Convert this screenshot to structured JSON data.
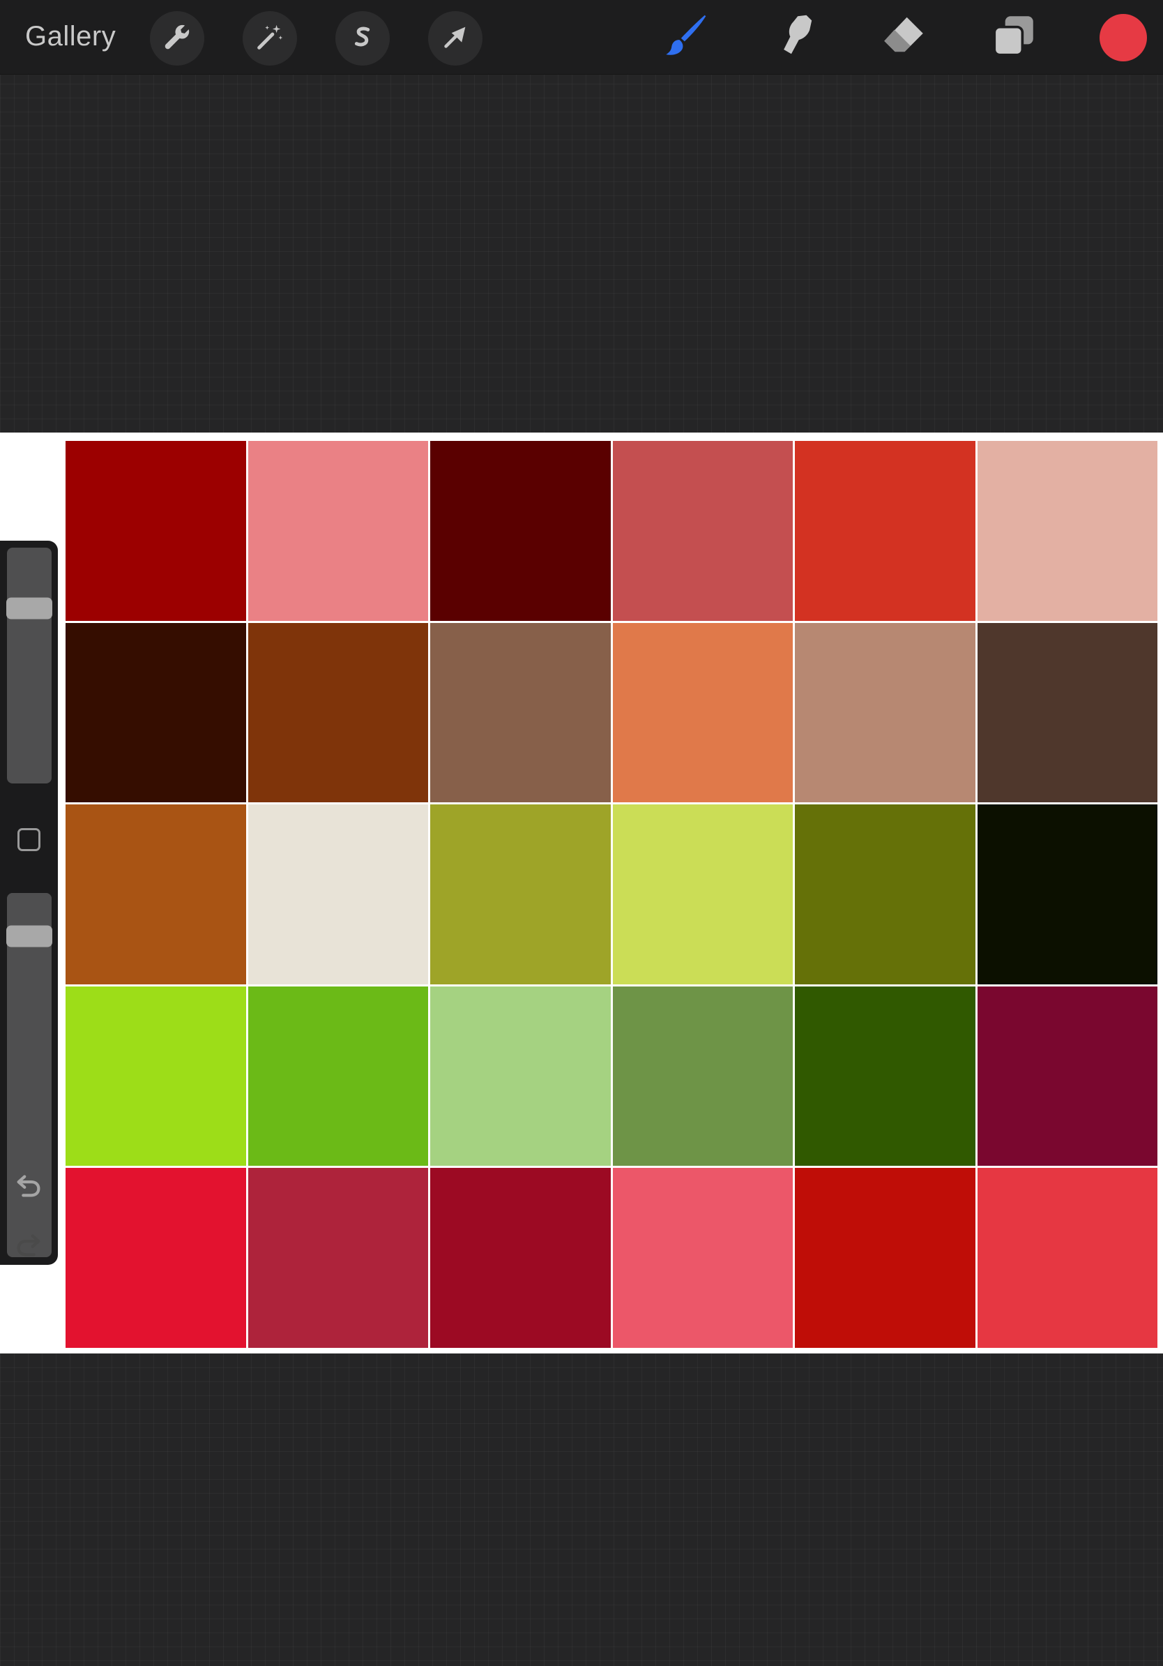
{
  "toolbar": {
    "gallery_label": "Gallery",
    "left_tools": [
      {
        "name": "actions",
        "icon": "wrench-icon"
      },
      {
        "name": "adjustments",
        "icon": "magic-wand-icon"
      },
      {
        "name": "selection",
        "icon": "selection-s-icon"
      },
      {
        "name": "transform",
        "icon": "arrow-cursor-icon"
      }
    ],
    "right_tools": [
      {
        "name": "brush",
        "icon": "brush-icon",
        "active": true,
        "color": "#2f6ff0"
      },
      {
        "name": "smudge",
        "icon": "smudge-finger-icon",
        "active": false,
        "color": "#c8c8c8"
      },
      {
        "name": "eraser",
        "icon": "eraser-icon",
        "active": false,
        "color": "#c8c8c8"
      },
      {
        "name": "layers",
        "icon": "layers-icon",
        "active": false,
        "color": "#c8c8c8"
      }
    ],
    "current_color": "#e63a44"
  },
  "sidebar": {
    "brush_size_level": 0.1,
    "brush_opacity_level": 0.0,
    "modify_button_icon": "square-icon",
    "undo_icon": "undo-icon",
    "redo_icon": "redo-icon",
    "redo_enabled": false
  },
  "canvas": {
    "background": "#ffffff",
    "swatches": [
      [
        "#9c0000",
        "#ea8185",
        "#5a0000",
        "#c44f50",
        "#d33222",
        "#e3b0a3"
      ],
      [
        "#350d00",
        "#7f340a",
        "#87604a",
        "#e0794a",
        "#b78872",
        "#4f372c"
      ],
      [
        "#a95414",
        "#e8e3d7",
        "#9ea428",
        "#cbdd56",
        "#657108",
        "#0c1000"
      ],
      [
        "#9ddd18",
        "#6bba17",
        "#a5d281",
        "#6e9447",
        "#305900",
        "#7a072f"
      ],
      [
        "#e3122f",
        "#ae233b",
        "#9c0a23",
        "#ec5769",
        "#bf0d07",
        "#e63742"
      ]
    ]
  }
}
